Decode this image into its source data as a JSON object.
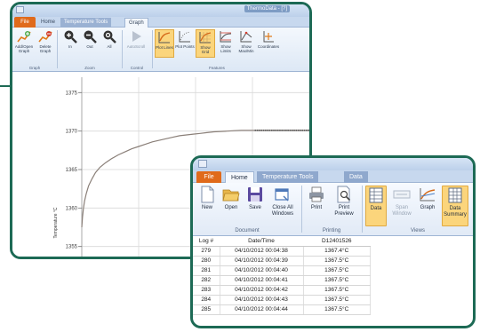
{
  "back_window": {
    "title": "ThermoData - [?]",
    "tabs": {
      "file": "File",
      "home": "Home",
      "tools": "Temperature Tools",
      "graph": "Graph"
    },
    "ribbon": {
      "add_open_graph": "Add/Open Graph",
      "delete_graph": "Delete Graph",
      "zoom_in": "In",
      "zoom_out": "Out",
      "zoom_all": "All",
      "autoscroll": "AutoScroll",
      "plot_lines": "Plot Lines",
      "plot_points": "Plot Points",
      "show_grid": "Show Grid",
      "show_limits": "Show Limits",
      "show_max_min": "Show Max/Min",
      "coordinates": "Coordinates",
      "groups": {
        "graph": "Graph",
        "zoom": "Zoom",
        "control": "Control",
        "features": "Features"
      }
    }
  },
  "chart_data": {
    "type": "line",
    "ylabel": "Temperature °C",
    "xlabel": "",
    "title": "",
    "yticks": [
      1375,
      1370,
      1365,
      1360,
      1355
    ],
    "ylim": [
      1353,
      1377
    ],
    "grid": true,
    "series": [
      {
        "x": [
          0,
          0.3,
          0.7,
          1.2,
          2,
          3,
          4.5,
          6,
          8,
          10.5,
          13,
          16,
          19,
          22,
          25,
          28,
          31,
          34,
          37,
          40,
          43,
          46,
          49,
          52,
          55,
          58,
          61,
          64,
          67,
          70,
          73,
          76,
          79,
          82,
          85,
          88,
          91,
          94,
          97,
          100
        ],
        "y": [
          1357.5,
          1358.8,
          1359.9,
          1360.9,
          1361.9,
          1362.9,
          1363.8,
          1364.6,
          1365.3,
          1365.9,
          1366.4,
          1366.9,
          1367.3,
          1367.7,
          1368.0,
          1368.3,
          1368.6,
          1368.8,
          1369.0,
          1369.2,
          1369.4,
          1369.5,
          1369.6,
          1369.7,
          1369.8,
          1369.9,
          1369.95,
          1370.0,
          1370.05,
          1370.1,
          1370.1,
          1370.1,
          1370.1,
          1370.1,
          1370.1,
          1370.1,
          1370.1,
          1370.1,
          1370.1,
          1370.1
        ]
      }
    ],
    "colors": {
      "line": "#8a7f78",
      "grid": "#d9d9d9"
    }
  },
  "front_window": {
    "tabs": {
      "file": "File",
      "home": "Home",
      "tools": "Temperature Tools",
      "data": "Data"
    },
    "ribbon": {
      "new": "New",
      "open": "Open",
      "save": "Save",
      "close_all": "Close All Windows",
      "print": "Print",
      "print_preview": "Print Preview",
      "data": "Data",
      "span_window": "Span Window",
      "graph": "Graph",
      "data_summary": "Data Summary",
      "groups": {
        "document": "Document",
        "printing": "Printing",
        "views": "Views"
      }
    },
    "table": {
      "headers": [
        "Log #",
        "Date/Time",
        "D12401526"
      ],
      "rows": [
        [
          "279",
          "04/10/2012 00:04:38",
          "1367.4°C"
        ],
        [
          "280",
          "04/10/2012 00:04:39",
          "1367.5°C"
        ],
        [
          "281",
          "04/10/2012 00:04:40",
          "1367.5°C"
        ],
        [
          "282",
          "04/10/2012 00:04:41",
          "1367.5°C"
        ],
        [
          "283",
          "04/10/2012 00:04:42",
          "1367.5°C"
        ],
        [
          "284",
          "04/10/2012 00:04:43",
          "1367.5°C"
        ],
        [
          "285",
          "04/10/2012 00:04:44",
          "1367.5°C"
        ]
      ]
    }
  },
  "colors": {
    "frame": "#1d6a55",
    "file_tab": "#e06a1b",
    "active_toggle": "#fbd57c"
  }
}
